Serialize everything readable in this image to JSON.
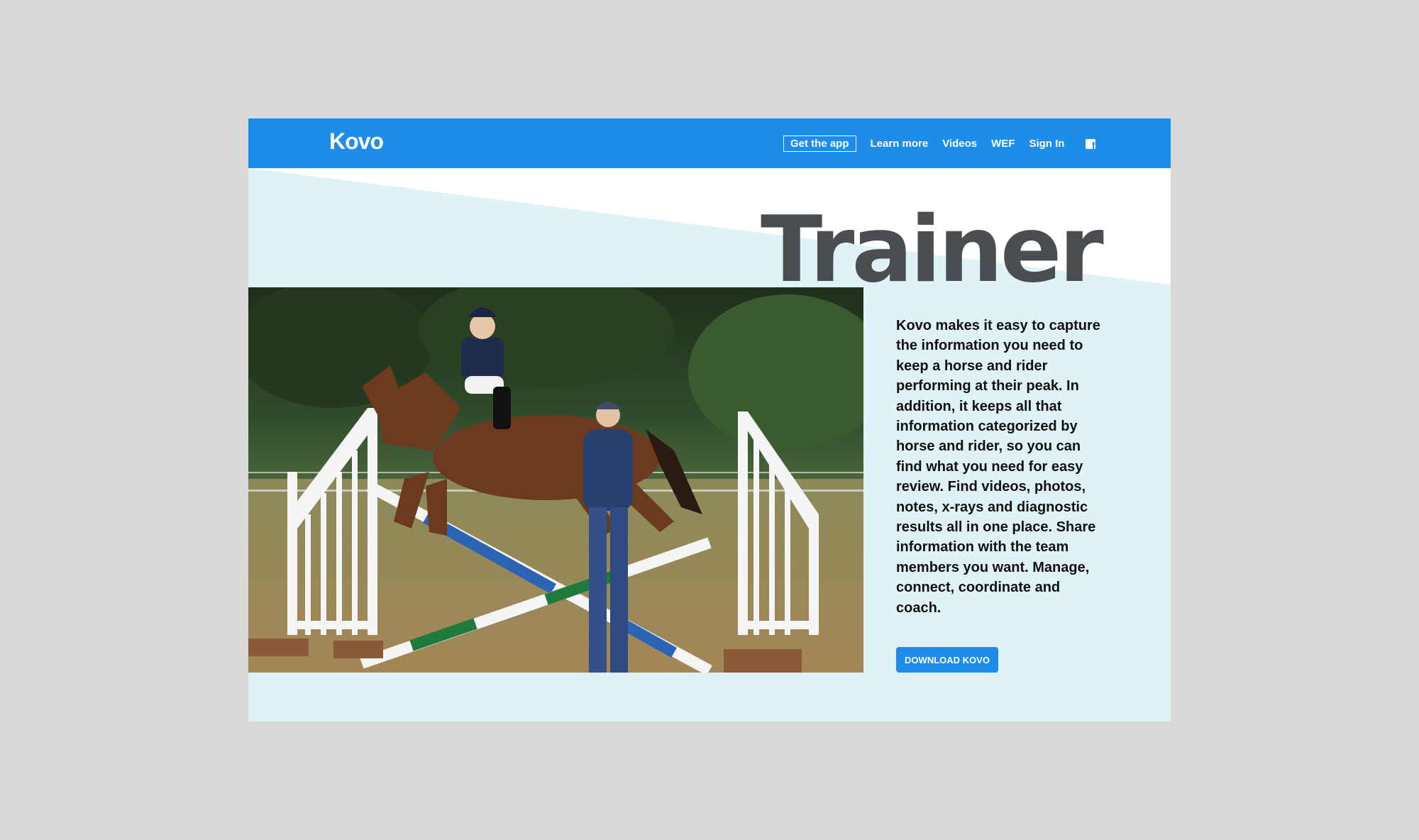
{
  "brand": {
    "logo": "Kovo"
  },
  "nav": {
    "items": [
      {
        "label": "Get the app",
        "boxed": true
      },
      {
        "label": "Learn more"
      },
      {
        "label": "Videos"
      },
      {
        "label": "WEF"
      },
      {
        "label": "Sign In"
      }
    ],
    "social_icon": "facebook-icon"
  },
  "hero": {
    "title": "Trainer",
    "description": "Kovo makes it easy to capture the information you need to keep a horse and rider performing at their peak. In addition, it keeps all that information categorized by horse and rider, so you can find what you need for easy review. Find videos, photos, notes, x-rays and diagnostic results all in one place. Share information with the team members you want. Manage, connect, coordinate and coach.",
    "cta_label": "DOWNLOAD KOVO"
  },
  "colors": {
    "brand_blue": "#1d8ceb",
    "light_panel": "#dff3f7",
    "title_gray": "#4a4d52",
    "page_bg": "#d9d9d9"
  }
}
